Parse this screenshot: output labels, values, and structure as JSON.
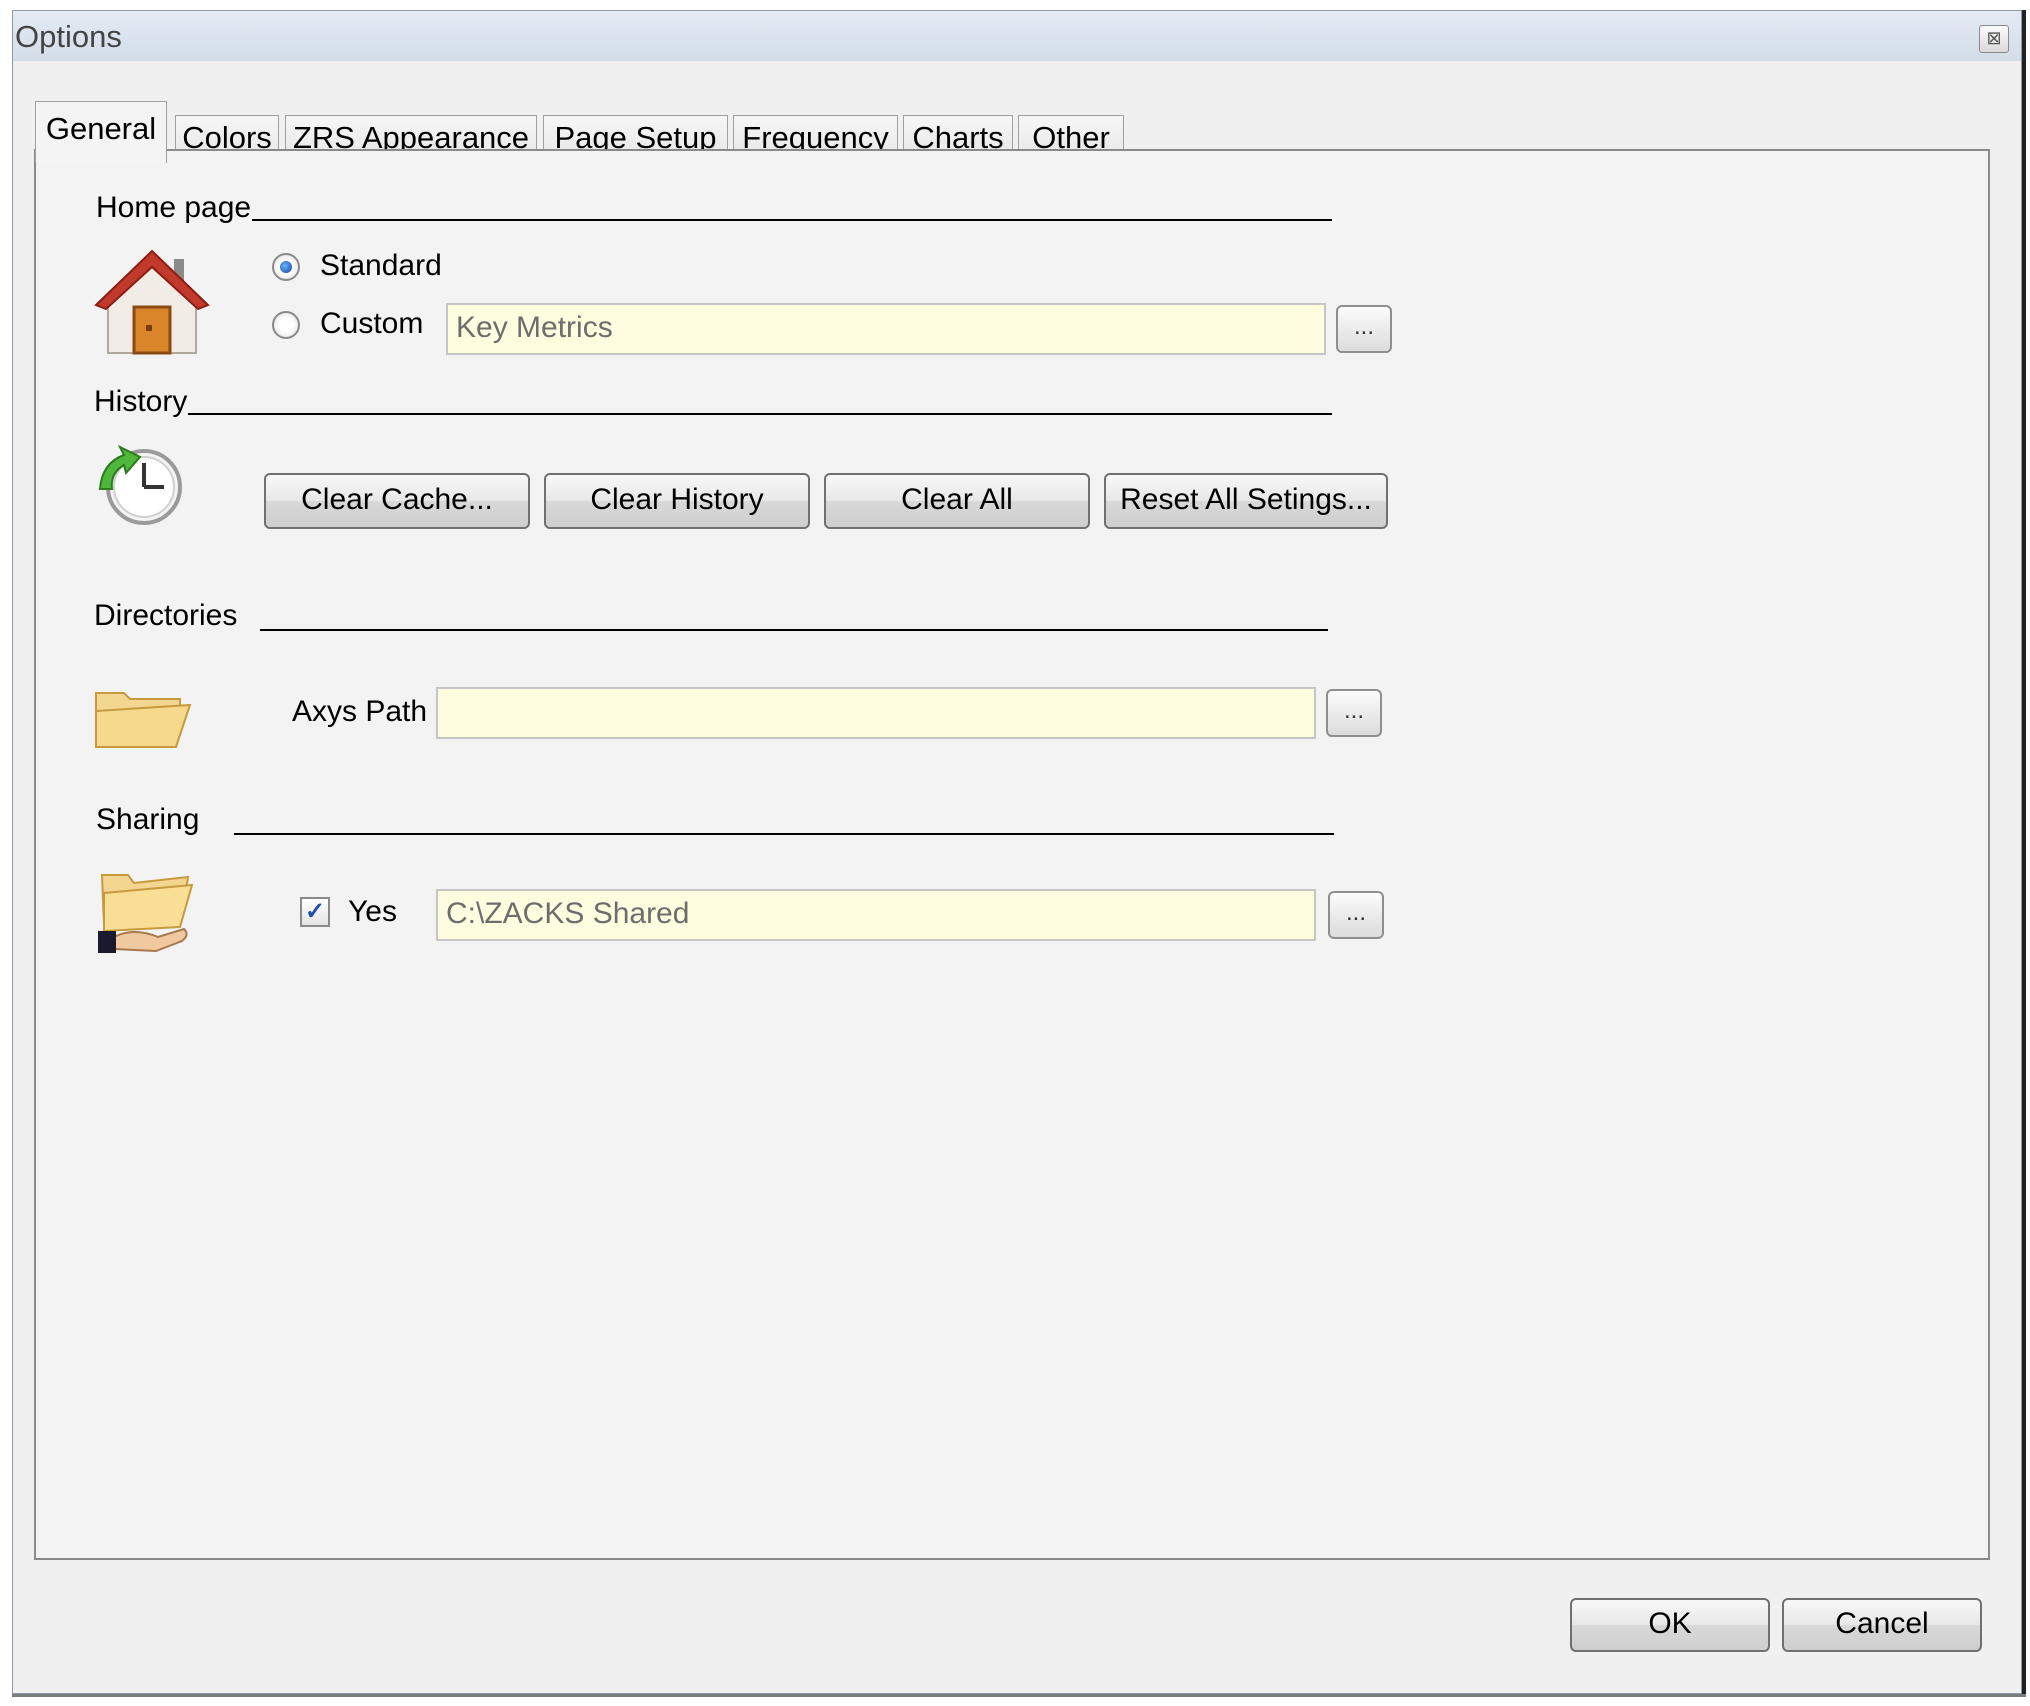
{
  "window": {
    "title": "Options",
    "close_glyph": "⊠"
  },
  "tabs": [
    {
      "label": "General",
      "active": true
    },
    {
      "label": "Colors"
    },
    {
      "label": "ZRS Appearance"
    },
    {
      "label": "Page Setup"
    },
    {
      "label": "Frequency"
    },
    {
      "label": "Charts"
    },
    {
      "label": "Other"
    }
  ],
  "home_page": {
    "heading": "Home page",
    "icon": "house-icon",
    "standard_label": "Standard",
    "standard_selected": true,
    "custom_label": "Custom",
    "custom_value": "Key Metrics",
    "browse_label": "..."
  },
  "history": {
    "heading": "History",
    "icon": "history-clock-icon",
    "buttons": [
      "Clear Cache...",
      "Clear History",
      "Clear All",
      "Reset All Setings..."
    ]
  },
  "directories": {
    "heading": "Directories",
    "icon": "open-folder-icon",
    "axys_path_label": "Axys Path",
    "axys_path_value": "",
    "browse_label": "..."
  },
  "sharing": {
    "heading": "Sharing",
    "icon": "shared-folder-icon",
    "yes_label": "Yes",
    "yes_checked": true,
    "path_value": "C:\\ZACKS Shared",
    "browse_label": "..."
  },
  "footer": {
    "ok_label": "OK",
    "cancel_label": "Cancel"
  },
  "colors": {
    "field_bg": "#fffde0",
    "dialog_bg": "#f0f0f0",
    "titlebar": "#dbe3ee"
  }
}
